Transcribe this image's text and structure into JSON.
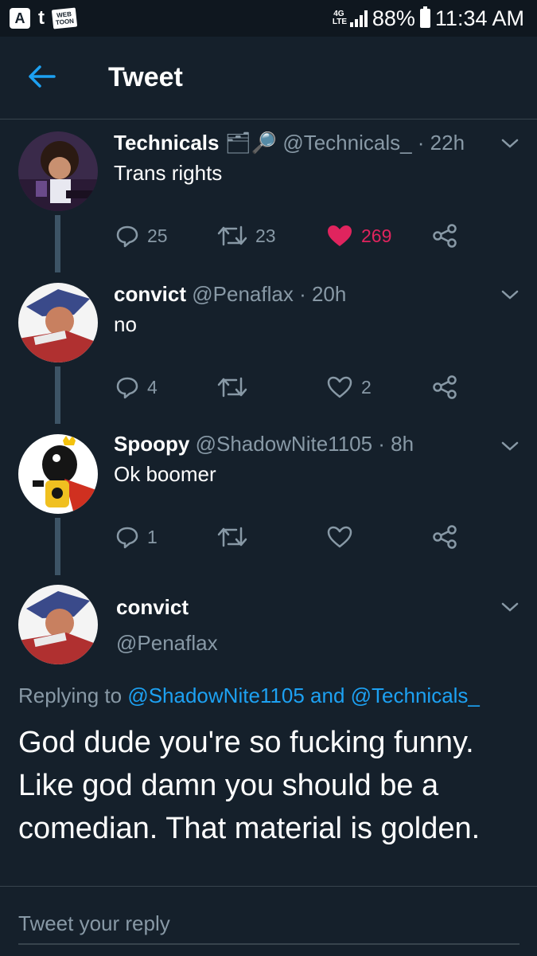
{
  "status_bar": {
    "network": "4G\nLTE",
    "battery": "88%",
    "time": "11:34 AM",
    "apps": [
      "app-a-icon",
      "tumblr-icon",
      "webtoon-icon"
    ],
    "webtoon_label_1": "WEB",
    "webtoon_label_2": "TOON",
    "tumblr_label": "t",
    "app_label": "A"
  },
  "header": {
    "title": "Tweet"
  },
  "tweets": [
    {
      "name": "Technicals",
      "badges": "🗂🔎",
      "handle": "@Technicals_",
      "time": " · 22h",
      "text": "Trans rights",
      "replies": "25",
      "retweets": "23",
      "likes": "269",
      "liked": true
    },
    {
      "name": "convict",
      "handle": "@Penaflax",
      "time": " · 20h",
      "text": "no",
      "replies": "4",
      "retweets": "",
      "likes": "2",
      "liked": false
    },
    {
      "name": "Spoopy",
      "handle": "@ShadowNite1105",
      "time": " · 8h",
      "text": "Ok boomer",
      "replies": "1",
      "retweets": "",
      "likes": "",
      "liked": false
    }
  ],
  "focused_tweet": {
    "name": "convict",
    "handle": "@Penaflax",
    "replying_prefix": "Replying to ",
    "replying_user_1": "@ShadowNite1105",
    "replying_and": " and ",
    "replying_user_2": "@Technicals_",
    "text": "God dude you're so fucking funny. Like god damn you should be a comedian. That material is golden."
  },
  "reply_box": {
    "placeholder": "Tweet your reply"
  },
  "colors": {
    "background": "#15202b",
    "accent": "#1da1f2",
    "like": "#e0245e",
    "secondary_text": "#8899a6"
  }
}
